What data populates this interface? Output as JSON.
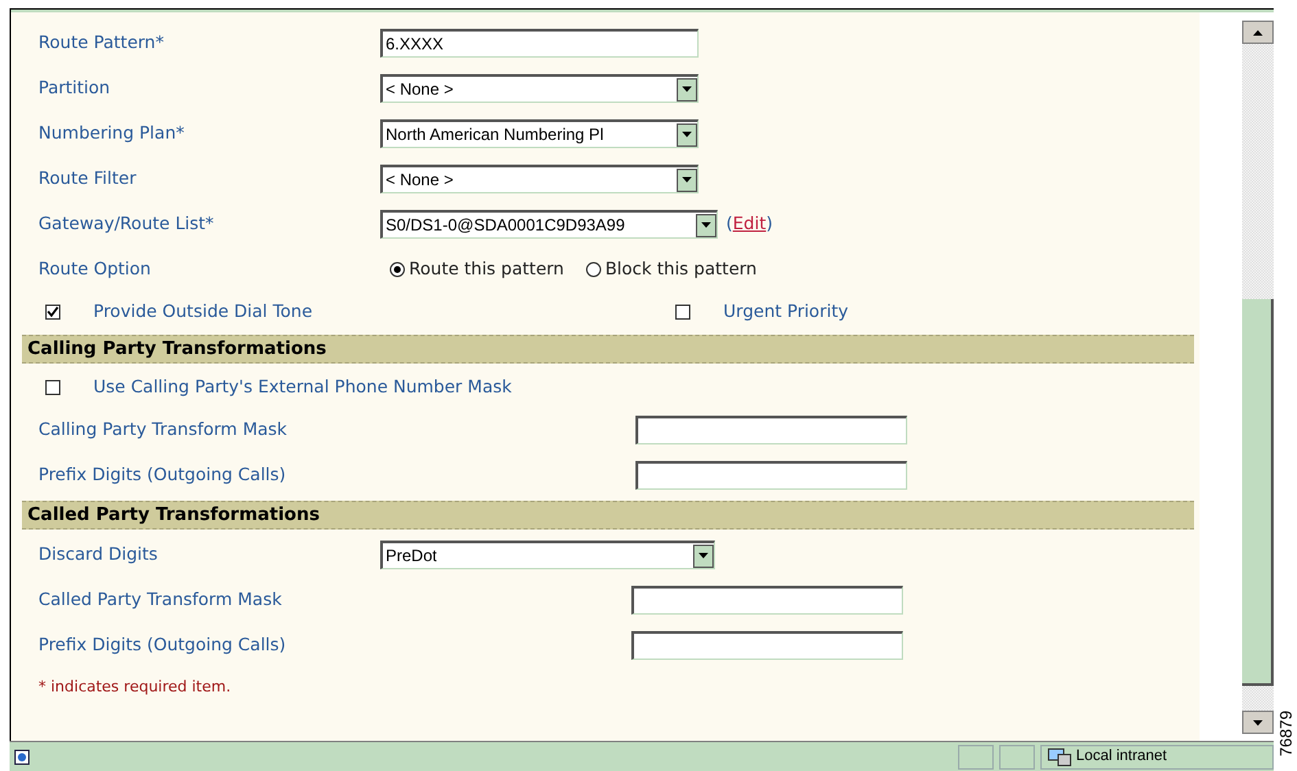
{
  "form": {
    "sections": [
      {
        "rows": [
          {
            "kind": "text",
            "label": "Route Pattern*",
            "value": "6.XXXX"
          },
          {
            "kind": "select",
            "label": "Partition",
            "value": "< None >"
          },
          {
            "kind": "select",
            "label": "Numbering Plan*",
            "value": "North American Numbering Pl"
          },
          {
            "kind": "select",
            "label": "Route Filter",
            "value": "< None >"
          },
          {
            "kind": "select",
            "label": "Gateway/Route List*",
            "value": "S0/DS1-0@SDA0001C9D93A99",
            "link": {
              "before": "(",
              "text": "Edit",
              "after": ")"
            }
          },
          {
            "kind": "radio",
            "label": "Route Option",
            "options": [
              {
                "label": "Route this pattern",
                "selected": true
              },
              {
                "label": "Block this pattern",
                "selected": false
              }
            ]
          },
          {
            "kind": "checkbox_pair",
            "items": [
              {
                "label": "Provide Outside Dial Tone",
                "checked": true
              },
              {
                "label": "Urgent Priority",
                "checked": false
              }
            ]
          }
        ]
      },
      {
        "header": "Calling Party Transformations",
        "rows": [
          {
            "kind": "checkbox",
            "label": "Use Calling Party's External Phone Number Mask",
            "checked": false
          },
          {
            "kind": "text",
            "label": "Calling Party Transform Mask",
            "value": ""
          },
          {
            "kind": "text",
            "label": "Prefix Digits (Outgoing Calls)",
            "value": ""
          }
        ]
      },
      {
        "header": "Called Party Transformations",
        "rows": [
          {
            "kind": "select",
            "label": "Discard Digits",
            "value": "PreDot"
          },
          {
            "kind": "text",
            "label": "Called Party Transform Mask",
            "value": ""
          },
          {
            "kind": "text",
            "label": "Prefix Digits (Outgoing Calls)",
            "value": ""
          }
        ]
      }
    ],
    "footnote": "* indicates required item."
  },
  "status_bar": {
    "zone": "Local intranet"
  },
  "figure_number": "76879"
}
